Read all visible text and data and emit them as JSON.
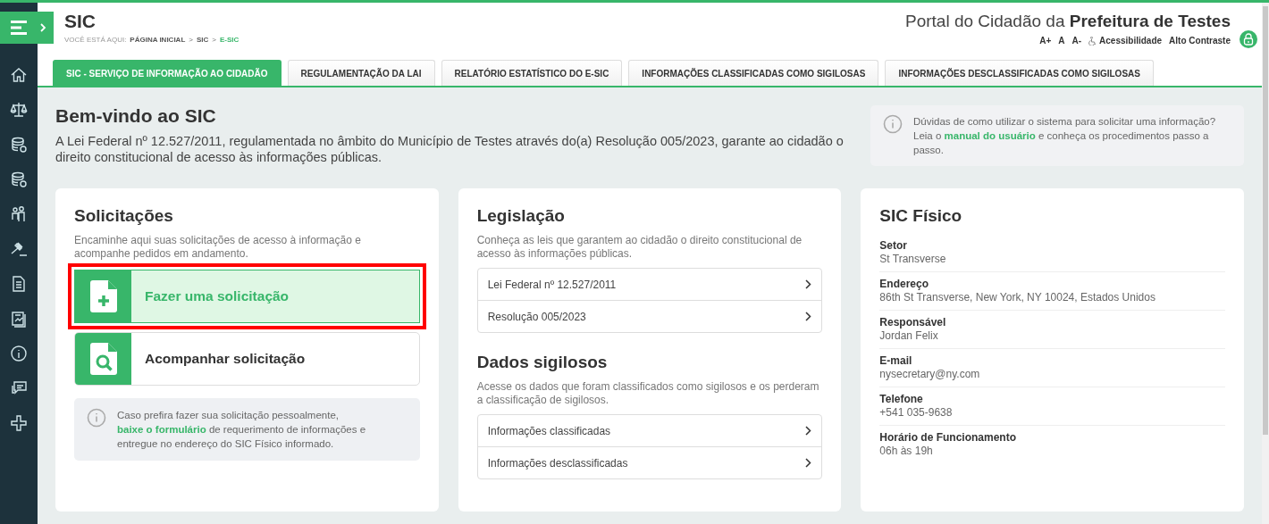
{
  "sidebar": {
    "items": [
      {
        "kind": "home"
      },
      {
        "kind": "scales"
      },
      {
        "kind": "coins"
      },
      {
        "kind": "coins"
      },
      {
        "kind": "people"
      },
      {
        "kind": "gavel"
      },
      {
        "kind": "document"
      },
      {
        "kind": "report"
      },
      {
        "kind": "info"
      },
      {
        "kind": "chat"
      },
      {
        "kind": "plus"
      }
    ]
  },
  "header": {
    "title": "SIC",
    "breadcrumb_label": "VOCÊ ESTÁ AQUI:",
    "separator": ">",
    "breadcrumb": [
      {
        "label": "PÁGINA INICIAL",
        "current": false
      },
      {
        "label": "SIC",
        "current": false
      },
      {
        "label": "E-SIC",
        "current": true
      }
    ],
    "portal_title": "Portal do Cidadão da **Prefeitura de Testes**",
    "accessibility": [
      {
        "label": "A+",
        "kind": "text"
      },
      {
        "label": "A",
        "kind": "text"
      },
      {
        "label": "A-",
        "kind": "text"
      },
      {
        "label": "Acessibilidade",
        "kind": "icon"
      },
      {
        "label": "Alto Contraste",
        "kind": "text"
      }
    ]
  },
  "tabs": [
    {
      "label": "SIC - SERVIÇO DE INFORMAÇÃO AO CIDADÃO",
      "selected": true
    },
    {
      "label": "REGULAMENTAÇÃO DA LAI",
      "selected": false
    },
    {
      "label": "RELATÓRIO ESTATÍSTICO DO E-SIC",
      "selected": false
    },
    {
      "label": "INFORMAÇÕES CLASSIFICADAS COMO SIGILOSAS",
      "selected": false
    },
    {
      "label": "INFORMAÇÕES DESCLASSIFICADAS COMO SIGILOSAS",
      "selected": false
    }
  ],
  "intro": {
    "title": "Bem-vindo ao SIC",
    "text": "A Lei Federal nº 12.527/2011, regulamentada no âmbito do Município de Testes através do(a) Resolução 005/2023, garante ao cidadão o direito constitucional de acesso às informações públicas.",
    "help": {
      "before": "Dúvidas de como utilizar o sistema para solicitar uma informação? Leia o",
      "link": "manual do usuário",
      "after": "e conheça os procedimentos passo a passo."
    }
  },
  "solicitacoes": {
    "title": "Solicitações",
    "description": "Encaminhe aqui suas solicitações de acesso à informação e acompanhe pedidos em andamento.",
    "actions": [
      {
        "label": "Fazer uma solicitação",
        "kind": "new",
        "highlighted": true
      },
      {
        "label": "Acompanhar solicitação",
        "kind": "search",
        "highlighted": false
      }
    ],
    "note": {
      "before": "Caso prefira fazer sua solicitação pessoalmente,",
      "link": "baixe o formulário",
      "after": "de requerimento de informações e entregue no endereço do SIC Físico informado."
    }
  },
  "legislacao": [
    {
      "title": "Legislação",
      "description": "Conheça as leis que garantem ao cidadão o direito constitucional de acesso às informações públicas.",
      "links": [
        "Lei Federal nº 12.527/2011",
        "Resolução 005/2023"
      ]
    },
    {
      "title": "Dados sigilosos",
      "description": "Acesse os dados que foram classificados como sigilosos e os perderam a classificação de sigilosos.",
      "links": [
        "Informações classificadas",
        "Informações desclassificadas"
      ]
    }
  ],
  "sic_fisico": {
    "title": "SIC Físico",
    "fields": [
      {
        "label": "Setor",
        "value": "St Transverse"
      },
      {
        "label": "Endereço",
        "value": "86th St Transverse, New York, NY 10024, Estados Unidos"
      },
      {
        "label": "Responsável",
        "value": "Jordan Felix"
      },
      {
        "label": "E-mail",
        "value": "nysecretary@ny.com"
      },
      {
        "label": "Telefone",
        "value": "+541 035-9638"
      },
      {
        "label": "Horário de Funcionamento",
        "value": "06h às 19h"
      }
    ]
  }
}
